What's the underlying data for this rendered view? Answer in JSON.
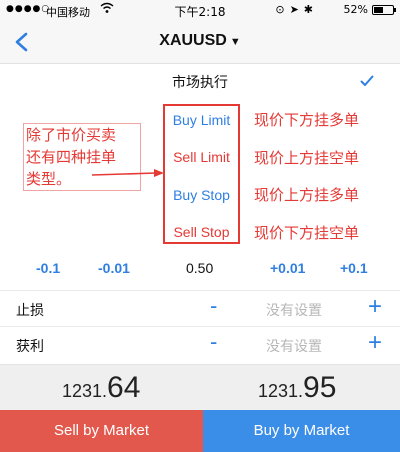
{
  "status_bar": {
    "signal": "●●●●○",
    "carrier": "中国移动",
    "wifi_icon": "wifi-icon",
    "time": "下午2:18",
    "battery_percent": "52%",
    "battery_level": 0.52
  },
  "nav": {
    "title": "XAUUSD",
    "caret": "▼",
    "back_icon": "chevron-left-icon"
  },
  "execution": {
    "label": "市场执行",
    "selected_icon": "checkmark-icon"
  },
  "order_types": [
    {
      "label": "Buy Limit",
      "description": "现价下方挂多单"
    },
    {
      "label": "Sell Limit",
      "description": "现价上方挂空单"
    },
    {
      "label": "Buy Stop",
      "description": "现价上方挂多单"
    },
    {
      "label": "Sell Stop",
      "description": "现价下方挂空单"
    }
  ],
  "annotation": {
    "lines": [
      "除了市价买卖",
      "还有四种挂单",
      "类型。"
    ]
  },
  "adjust": {
    "minus_big": "-0.1",
    "minus_small": "-0.01",
    "value": "0.50",
    "plus_small": "+0.01",
    "plus_big": "+0.1"
  },
  "stop_loss": {
    "label": "止损",
    "minus": "-",
    "placeholder": "没有设置",
    "plus": "+"
  },
  "take_profit": {
    "label": "获利",
    "minus": "-",
    "placeholder": "没有设置",
    "plus": "+"
  },
  "prices": {
    "sell_main": "1231.",
    "sell_big": "64",
    "buy_main": "1231.",
    "buy_big": "95"
  },
  "buttons": {
    "sell": "Sell by Market",
    "buy": "Buy by Market"
  },
  "colors": {
    "accent_blue": "#2f7fe2",
    "annotation_red": "#e53935",
    "sell_red": "#e2584d",
    "buy_blue": "#3b8ee8"
  }
}
